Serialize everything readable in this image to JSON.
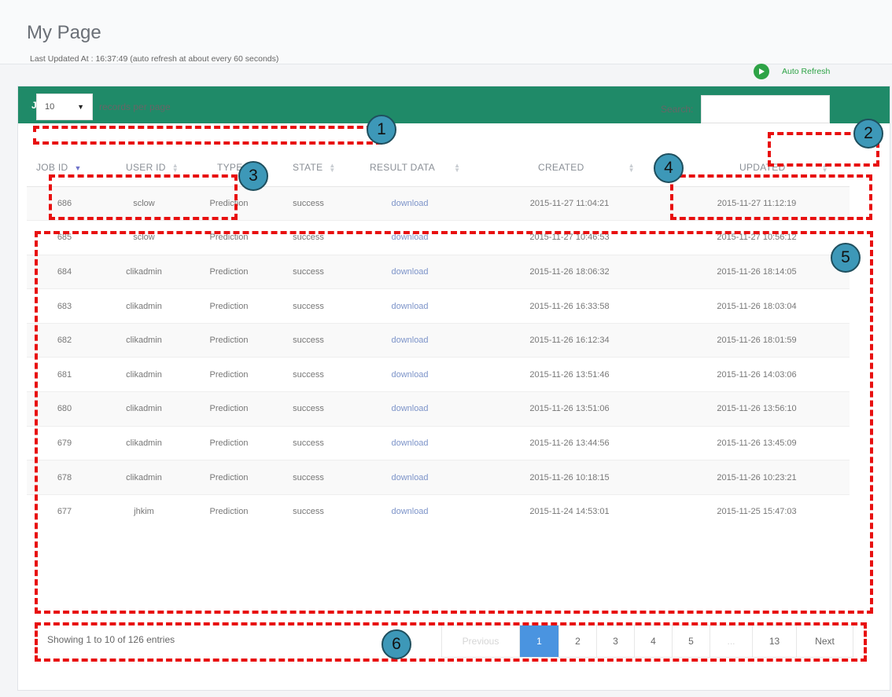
{
  "page": {
    "title": "My Page"
  },
  "panel": {
    "title": "JOB"
  },
  "status": {
    "last_updated": "Last Updated At : 16:37:49 (auto refresh at about every 60 seconds)"
  },
  "auto_refresh": {
    "label": "Auto Refresh",
    "icon": "play-circle-icon",
    "color": "#2ea346"
  },
  "length_menu": {
    "selected": "10",
    "label": "records per page"
  },
  "search": {
    "label": "Search:",
    "value": "",
    "placeholder": ""
  },
  "table": {
    "columns": [
      "JOB ID",
      "USER ID",
      "TYPE",
      "STATE",
      "RESULT DATA",
      "CREATED",
      "UPDATED"
    ],
    "sorted_column": "JOB ID",
    "rows": [
      {
        "job_id": "686",
        "user_id": "sclow",
        "type": "Prediction",
        "state": "success",
        "result": "download",
        "created": "2015-11-27 11:04:21",
        "updated": "2015-11-27 11:12:19"
      },
      {
        "job_id": "685",
        "user_id": "sclow",
        "type": "Prediction",
        "state": "success",
        "result": "download",
        "created": "2015-11-27 10:46:53",
        "updated": "2015-11-27 10:56:12"
      },
      {
        "job_id": "684",
        "user_id": "clikadmin",
        "type": "Prediction",
        "state": "success",
        "result": "download",
        "created": "2015-11-26 18:06:32",
        "updated": "2015-11-26 18:14:05"
      },
      {
        "job_id": "683",
        "user_id": "clikadmin",
        "type": "Prediction",
        "state": "success",
        "result": "download",
        "created": "2015-11-26 16:33:58",
        "updated": "2015-11-26 18:03:04"
      },
      {
        "job_id": "682",
        "user_id": "clikadmin",
        "type": "Prediction",
        "state": "success",
        "result": "download",
        "created": "2015-11-26 16:12:34",
        "updated": "2015-11-26 18:01:59"
      },
      {
        "job_id": "681",
        "user_id": "clikadmin",
        "type": "Prediction",
        "state": "success",
        "result": "download",
        "created": "2015-11-26 13:51:46",
        "updated": "2015-11-26 14:03:06"
      },
      {
        "job_id": "680",
        "user_id": "clikadmin",
        "type": "Prediction",
        "state": "success",
        "result": "download",
        "created": "2015-11-26 13:51:06",
        "updated": "2015-11-26 13:56:10"
      },
      {
        "job_id": "679",
        "user_id": "clikadmin",
        "type": "Prediction",
        "state": "success",
        "result": "download",
        "created": "2015-11-26 13:44:56",
        "updated": "2015-11-26 13:45:09"
      },
      {
        "job_id": "678",
        "user_id": "clikadmin",
        "type": "Prediction",
        "state": "success",
        "result": "download",
        "created": "2015-11-26 10:18:15",
        "updated": "2015-11-26 10:23:21"
      },
      {
        "job_id": "677",
        "user_id": "jhkim",
        "type": "Prediction",
        "state": "success",
        "result": "download",
        "created": "2015-11-24 14:53:01",
        "updated": "2015-11-25 15:47:03"
      }
    ]
  },
  "footer": {
    "showing": "Showing 1 to 10 of 126 entries"
  },
  "pagination": {
    "previous": "Previous",
    "pages": [
      "1",
      "2",
      "3",
      "4",
      "5",
      "...",
      "13"
    ],
    "active": "1",
    "next": "Next"
  },
  "annotations": [
    "1",
    "2",
    "3",
    "4",
    "5",
    "6"
  ],
  "colors": {
    "header": "#1f8a68",
    "state_success": "#e64646",
    "link": "#7d94c9",
    "page_active": "#4a94e0",
    "annotation_box": "#e81010",
    "annotation_badge": "#3d98b8"
  }
}
